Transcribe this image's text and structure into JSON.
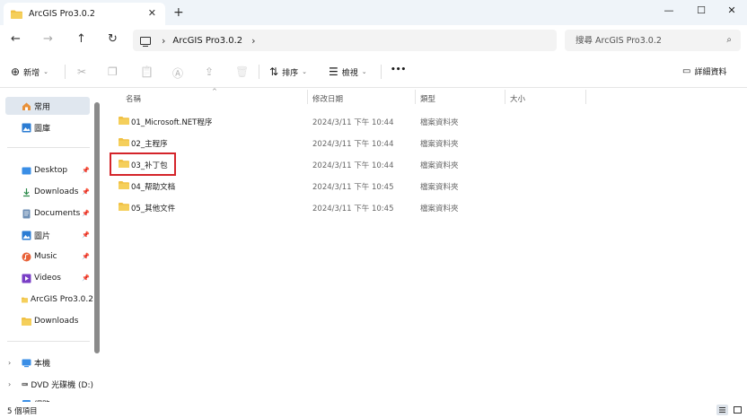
{
  "colors": {
    "folder": "#f0c043",
    "folder_dark": "#dba51d",
    "selection": "#e0e7ef",
    "highlight": "#d4242a",
    "accent": "#0067c0"
  },
  "window": {
    "tab_title": "ArcGIS Pro3.0.2",
    "tab_close": "✕",
    "new_tab": "+",
    "minimize": "—",
    "maximize": "☐",
    "close": "✕"
  },
  "nav": {
    "back": "←",
    "forward": "→",
    "up": "↑",
    "refresh": "↻",
    "crumb_sep": "›",
    "crumbs": [
      "ArcGIS Pro3.0.2"
    ],
    "crumb_end": "›",
    "search_placeholder": "搜尋 ArcGIS Pro3.0.2",
    "search_icon": "⌕"
  },
  "toolbar": {
    "new_label": "新增",
    "new_icon": "⊕",
    "cut_icon": "✂",
    "copy_icon": "❐",
    "paste_icon": "📋",
    "rename_icon": "Ⓐ",
    "share_icon": "⇪",
    "delete_icon": "🗑",
    "sort_label": "排序",
    "sort_icon": "⇅",
    "view_label": "檢視",
    "view_icon": "☰",
    "more": "•••",
    "details_label": "詳細資料",
    "details_icon": "▭",
    "caret": "⌄"
  },
  "sidebar": {
    "items": [
      {
        "label": "常用",
        "icon": "home-icon"
      },
      {
        "label": "圖庫",
        "icon": "gallery-icon"
      },
      {
        "label": "Desktop",
        "icon": "desktop-icon",
        "pinned": true
      },
      {
        "label": "Downloads",
        "icon": "downloads-icon",
        "pinned": true
      },
      {
        "label": "Documents",
        "icon": "documents-icon",
        "pinned": true
      },
      {
        "label": "圖片",
        "icon": "pictures-icon",
        "pinned": true
      },
      {
        "label": "Music",
        "icon": "music-icon",
        "pinned": true
      },
      {
        "label": "Videos",
        "icon": "videos-icon",
        "pinned": true
      },
      {
        "label": "ArcGIS Pro3.0.2",
        "icon": "folder-icon"
      },
      {
        "label": "Downloads",
        "icon": "folder-icon"
      },
      {
        "label": "本機",
        "icon": "this-pc-icon"
      },
      {
        "label": "DVD 光碟機 (D:)",
        "icon": "dvd-icon"
      },
      {
        "label": "網路",
        "icon": "network-icon"
      }
    ],
    "pin_glyph": "📌",
    "expand_glyph": "›"
  },
  "filelist": {
    "columns": [
      "名稱",
      "修改日期",
      "類型",
      "大小"
    ],
    "sort_glyph": "^",
    "rows": [
      {
        "name": "01_Microsoft.NET程序",
        "date": "2024/3/11 下午 10:44",
        "type": "檔案資料夾"
      },
      {
        "name": "02_主程序",
        "date": "2024/3/11 下午 10:44",
        "type": "檔案資料夾"
      },
      {
        "name": "03_补丁包",
        "date": "2024/3/11 下午 10:44",
        "type": "檔案資料夾",
        "highlighted": true
      },
      {
        "name": "04_帮助文档",
        "date": "2024/3/11 下午 10:45",
        "type": "檔案資料夾"
      },
      {
        "name": "05_其他文件",
        "date": "2024/3/11 下午 10:45",
        "type": "檔案資料夾"
      }
    ]
  },
  "status": {
    "count": "5 個項目"
  }
}
